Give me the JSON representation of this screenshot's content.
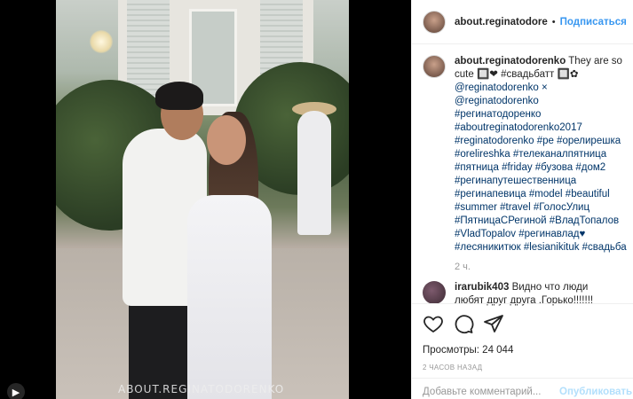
{
  "post": {
    "watermark": "ABOUT.REGINATODORENKO",
    "media_icon": "▶"
  },
  "header": {
    "username": "about.reginatodore",
    "separator": "•",
    "follow_label": "Подписаться"
  },
  "caption": {
    "username": "about.reginatodorenko",
    "text_intro": " They are so cute ",
    "lines": [
      "🔲❤ #свадьбатт 🔲✿",
      "@reginatodorenko ×",
      "@reginatodorenko",
      "#регинатодоренко",
      "#aboutreginatodorenko2017",
      "#reginatodorenko #ре #орелирешка",
      "#orelireshka #телеканалпятница",
      "#пятница #friday #бузова #дом2",
      "#регинапутешественница",
      "#регинапевица #model #beautiful",
      "#summer #travel #ГолосУлиц",
      "#ПятницаСРегиной #ВладТопалов",
      "#VladTopalov #регинавлад♥",
      "#лесяникитюк #lesianikituk #свадьба"
    ],
    "time_ago": "2 ч."
  },
  "comment": {
    "username": "irarubik403",
    "text": " Видно что люди любят друг друга .Горько!!!!!!!"
  },
  "actions": {
    "like_icon": "heart-icon",
    "comment_icon": "comment-icon",
    "share_icon": "share-icon",
    "views_label": "Просмотры: 24 044",
    "posted_label": "2 ЧАСОВ НАЗАД"
  },
  "add_comment": {
    "placeholder": "Добавьте комментарий...",
    "publish_label": "Опубликовать"
  }
}
